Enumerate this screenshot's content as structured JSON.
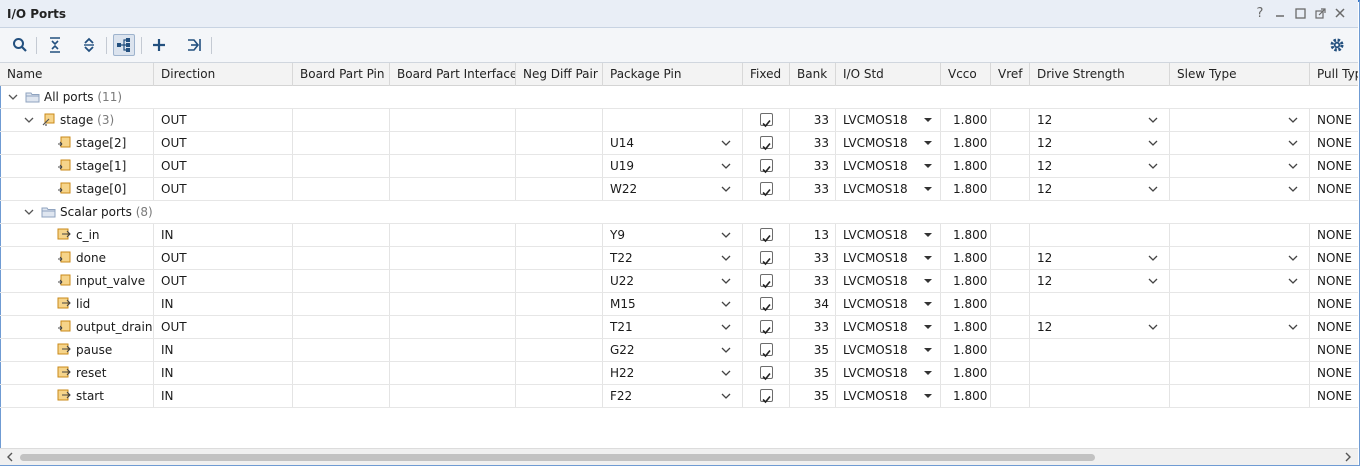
{
  "window": {
    "title": "I/O Ports",
    "controls": [
      "help-icon",
      "minimize-icon",
      "restore-icon",
      "float-icon",
      "close-icon"
    ]
  },
  "toolbar": {
    "icons": [
      "search-icon",
      "collapse-all-icon",
      "expand-all-icon",
      "group-by-interface-icon",
      "add-icon",
      "export-icon"
    ],
    "settings_icon": "gear-icon"
  },
  "columns": [
    "Name",
    "Direction",
    "Board Part Pin",
    "Board Part Interface",
    "Neg Diff Pair",
    "Package Pin",
    "Fixed",
    "Bank",
    "I/O Std",
    "Vcco",
    "Vref",
    "Drive Strength",
    "Slew Type",
    "Pull Typ"
  ],
  "groups": {
    "all_ports": {
      "label": "All ports",
      "count": "(11)"
    },
    "bus": {
      "name": "stage",
      "count": "(3)",
      "direction": "OUT",
      "bank": "33",
      "iostd": "LVCMOS18",
      "vcco": "1.800",
      "drive": "12",
      "pull": "NONE"
    },
    "scalar": {
      "label": "Scalar ports",
      "count": "(8)"
    }
  },
  "bus_rows": [
    {
      "name": "stage[2]",
      "direction": "OUT",
      "pin": "U14",
      "bank": "33",
      "iostd": "LVCMOS18",
      "vcco": "1.800",
      "drive": "12",
      "pull": "NONE"
    },
    {
      "name": "stage[1]",
      "direction": "OUT",
      "pin": "U19",
      "bank": "33",
      "iostd": "LVCMOS18",
      "vcco": "1.800",
      "drive": "12",
      "pull": "NONE"
    },
    {
      "name": "stage[0]",
      "direction": "OUT",
      "pin": "W22",
      "bank": "33",
      "iostd": "LVCMOS18",
      "vcco": "1.800",
      "drive": "12",
      "pull": "NONE"
    }
  ],
  "scalar_rows": [
    {
      "name": "c_in",
      "direction": "IN",
      "pin": "Y9",
      "bank": "13",
      "iostd": "LVCMOS18",
      "vcco": "1.800",
      "drive": "",
      "pull": "NONE"
    },
    {
      "name": "done",
      "direction": "OUT",
      "pin": "T22",
      "bank": "33",
      "iostd": "LVCMOS18",
      "vcco": "1.800",
      "drive": "12",
      "pull": "NONE"
    },
    {
      "name": "input_valve",
      "direction": "OUT",
      "pin": "U22",
      "bank": "33",
      "iostd": "LVCMOS18",
      "vcco": "1.800",
      "drive": "12",
      "pull": "NONE"
    },
    {
      "name": "lid",
      "direction": "IN",
      "pin": "M15",
      "bank": "34",
      "iostd": "LVCMOS18",
      "vcco": "1.800",
      "drive": "",
      "pull": "NONE"
    },
    {
      "name": "output_drain",
      "direction": "OUT",
      "pin": "T21",
      "bank": "33",
      "iostd": "LVCMOS18",
      "vcco": "1.800",
      "drive": "12",
      "pull": "NONE"
    },
    {
      "name": "pause",
      "direction": "IN",
      "pin": "G22",
      "bank": "35",
      "iostd": "LVCMOS18",
      "vcco": "1.800",
      "drive": "",
      "pull": "NONE"
    },
    {
      "name": "reset",
      "direction": "IN",
      "pin": "H22",
      "bank": "35",
      "iostd": "LVCMOS18",
      "vcco": "1.800",
      "drive": "",
      "pull": "NONE"
    },
    {
      "name": "start",
      "direction": "IN",
      "pin": "F22",
      "bank": "35",
      "iostd": "LVCMOS18",
      "vcco": "1.800",
      "drive": "",
      "pull": "NONE"
    }
  ],
  "colors": {
    "accent": "#3a78c9",
    "port_icon": "#e0a437",
    "folder_icon": "#8fa3bf"
  }
}
